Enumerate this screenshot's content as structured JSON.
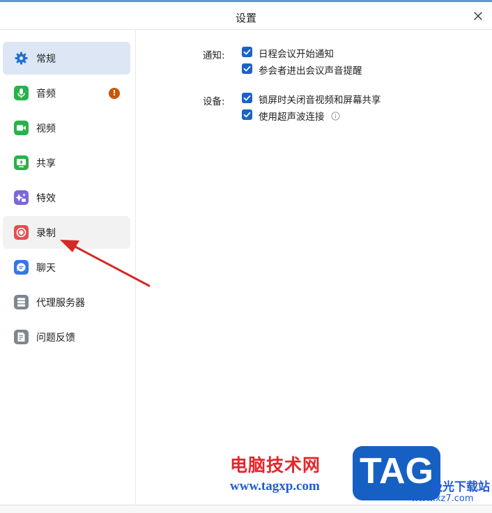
{
  "window": {
    "title": "设置"
  },
  "sidebar": {
    "items": [
      {
        "label": "常规",
        "icon": "gear-icon",
        "color": "#1f6fd8"
      },
      {
        "label": "音频",
        "icon": "microphone-icon",
        "color": "#27b24a",
        "badge": "!"
      },
      {
        "label": "视频",
        "icon": "video-camera-icon",
        "color": "#27b24a"
      },
      {
        "label": "共享",
        "icon": "share-screen-icon",
        "color": "#27b24a"
      },
      {
        "label": "特效",
        "icon": "effects-icon",
        "color": "#7f66d9"
      },
      {
        "label": "录制",
        "icon": "record-icon",
        "color": "#e24f4f"
      },
      {
        "label": "聊天",
        "icon": "chat-icon",
        "color": "#3577e5"
      },
      {
        "label": "代理服务器",
        "icon": "server-icon",
        "color": "#7e8691"
      },
      {
        "label": "问题反馈",
        "icon": "feedback-icon",
        "color": "#7e8691"
      }
    ]
  },
  "main": {
    "notifications": {
      "label": "通知:",
      "options": [
        {
          "label": "日程会议开始通知",
          "checked": true
        },
        {
          "label": "参会者进出会议声音提醒",
          "checked": true
        }
      ]
    },
    "device": {
      "label": "设备:",
      "options": [
        {
          "label": "锁屏时关闭音视频和屏幕共享",
          "checked": true
        },
        {
          "label": "使用超声波连接",
          "checked": true,
          "info_icon": "info-icon"
        }
      ]
    }
  },
  "watermark": {
    "brand_cn": "电脑技术网",
    "url": "www.tagxp.com",
    "tag": "TAG",
    "site_cn": "极光下载站",
    "site_url": "www.xz7.com"
  },
  "colors": {
    "accent": "#1a63c8",
    "active_bg": "#dde6f5",
    "arrow": "#d42a26"
  }
}
